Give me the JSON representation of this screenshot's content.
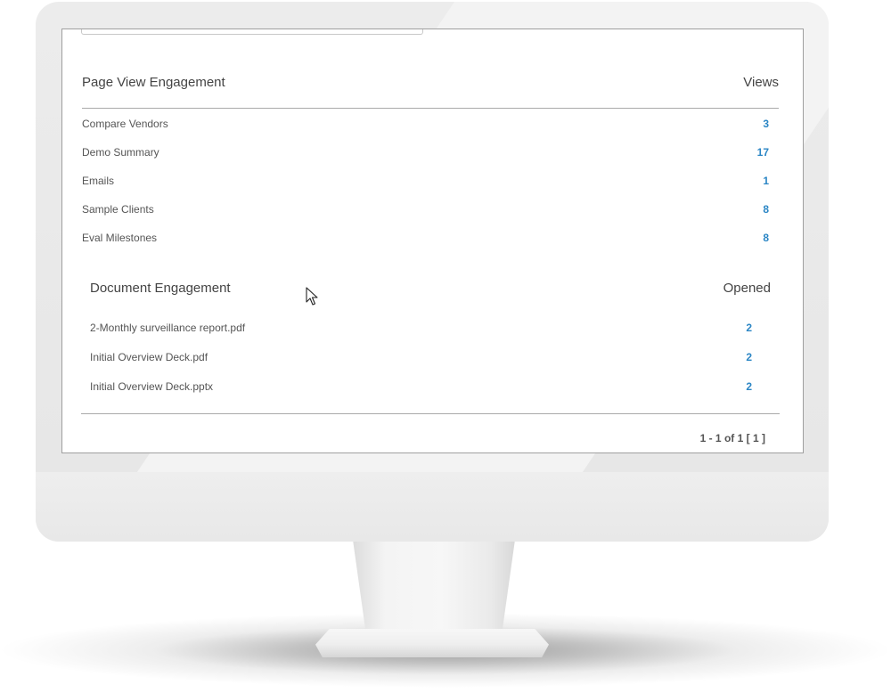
{
  "page_views": {
    "title": "Page View Engagement",
    "column": "Views",
    "rows": [
      {
        "label": "Compare Vendors",
        "value": "3"
      },
      {
        "label": "Demo Summary",
        "value": "17"
      },
      {
        "label": "Emails",
        "value": "1"
      },
      {
        "label": "Sample Clients",
        "value": "8"
      },
      {
        "label": "Eval Milestones",
        "value": "8"
      }
    ]
  },
  "documents": {
    "title": "Document Engagement",
    "column": "Opened",
    "rows": [
      {
        "label": "2-Monthly surveillance report.pdf",
        "value": "2"
      },
      {
        "label": "Initial Overview Deck.pdf",
        "value": "2"
      },
      {
        "label": "Initial Overview Deck.pptx",
        "value": "2"
      }
    ]
  },
  "pagination": {
    "range": "1 - 1",
    "of_label": "of",
    "total": "1",
    "page": "[ 1 ]"
  },
  "colors": {
    "link": "#2b86c5",
    "text": "#444444",
    "bezel": "#e8e8e8"
  },
  "icons": [
    "mouse-pointer-icon"
  ]
}
